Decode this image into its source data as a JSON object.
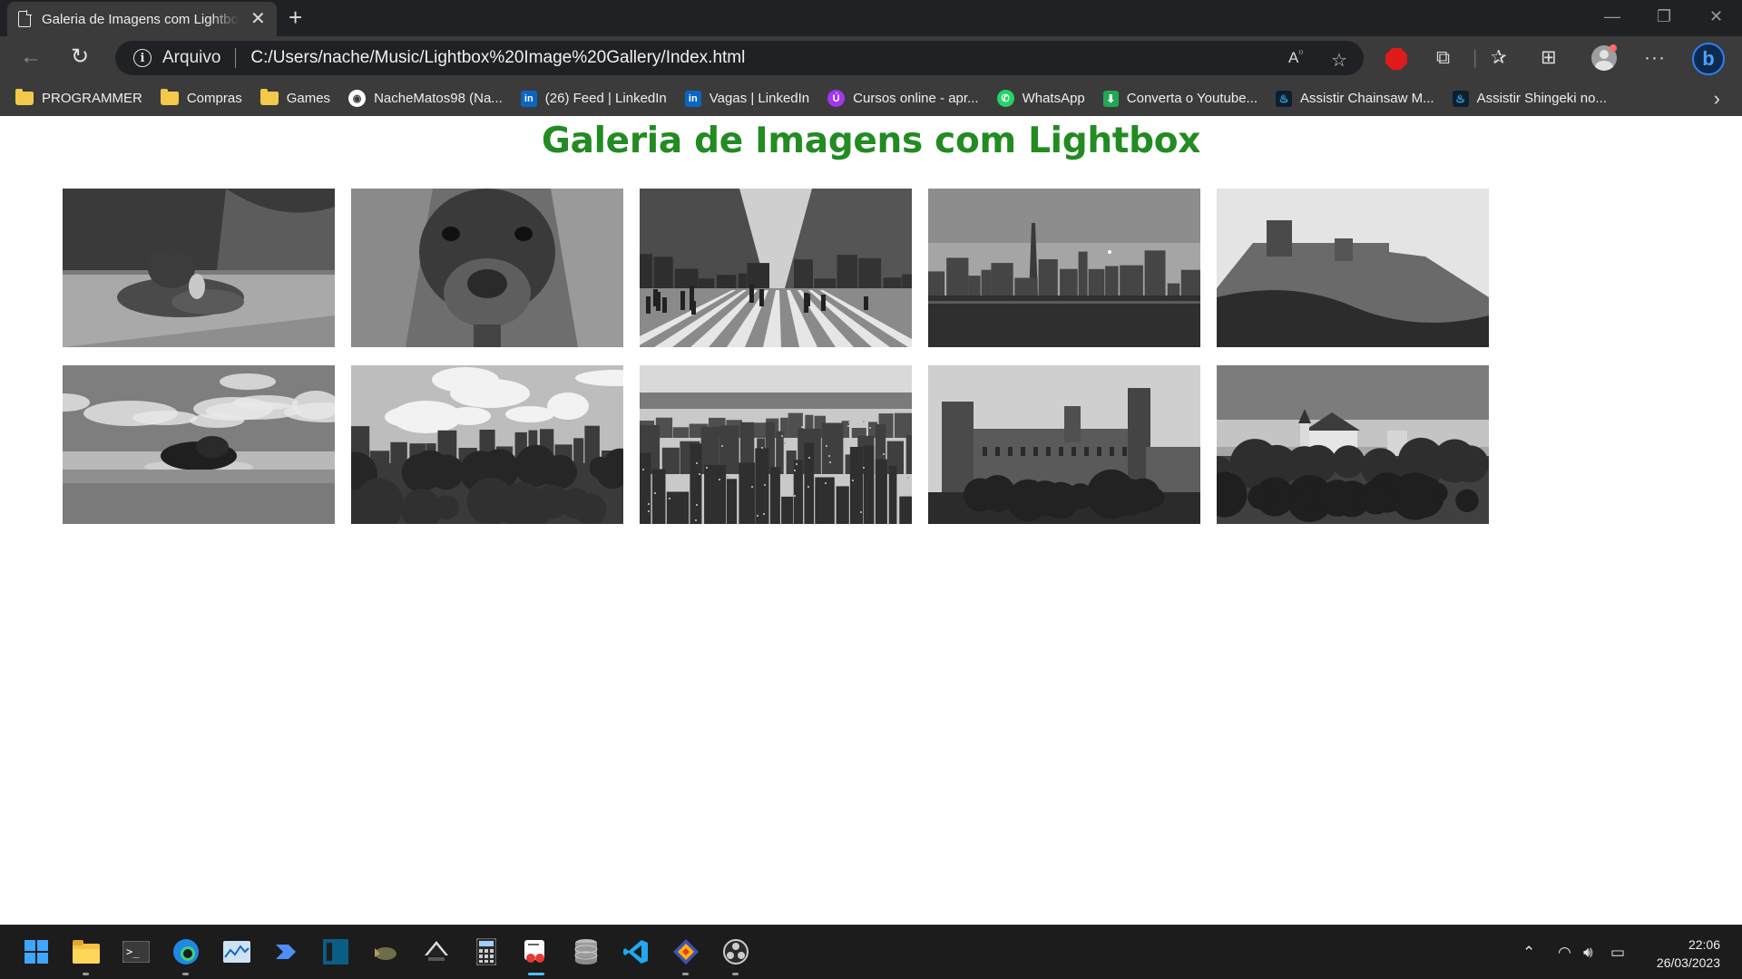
{
  "browser": {
    "tab_title": "Galeria de Imagens com Lightbox",
    "security_label": "Arquivo",
    "url": "C:/Users/nache/Music/Lightbox%20Image%20Gallery/Index.html",
    "read_aloud_label": "A₀"
  },
  "bookmarks": [
    {
      "label": "PROGRAMMER",
      "icon": "folder-icon"
    },
    {
      "label": "Compras",
      "icon": "folder-icon"
    },
    {
      "label": "Games",
      "icon": "folder-icon"
    },
    {
      "label": "NacheMatos98 (Na...",
      "icon": "github-icon"
    },
    {
      "label": "(26) Feed | LinkedIn",
      "icon": "linkedin-icon"
    },
    {
      "label": "Vagas | LinkedIn",
      "icon": "linkedin-icon"
    },
    {
      "label": "Cursos online - apr...",
      "icon": "udemy-icon"
    },
    {
      "label": "WhatsApp",
      "icon": "whatsapp-icon"
    },
    {
      "label": "Converta o Youtube...",
      "icon": "download-icon"
    },
    {
      "label": "Assistir Chainsaw M...",
      "icon": "flame-icon"
    },
    {
      "label": "Assistir Shingeki no...",
      "icon": "flame-icon"
    }
  ],
  "page": {
    "title": "Galeria de Imagens com Lightbox",
    "title_color": "#228b22",
    "gallery": [
      {
        "subject": "dog-lying-on-pavement"
      },
      {
        "subject": "dog-closeup-nose"
      },
      {
        "subject": "city-street-crosswalk"
      },
      {
        "subject": "city-skyline-waterfront"
      },
      {
        "subject": "castle-on-cliff"
      },
      {
        "subject": "tropical-island"
      },
      {
        "subject": "city-skyline-park"
      },
      {
        "subject": "aerial-city-skyscrapers"
      },
      {
        "subject": "stone-castle"
      },
      {
        "subject": "fairytale-castle-forest"
      }
    ]
  },
  "taskbar": {
    "apps": [
      "start-icon",
      "file-explorer-icon",
      "terminal-icon",
      "edge-icon",
      "task-manager-icon",
      "power-automate-icon",
      "jetbrains-icon",
      "crossover-icon",
      "inkscape-icon",
      "calculator-icon",
      "snipping-tool-icon",
      "database-icon",
      "vscode-icon",
      "git-icon",
      "obs-icon"
    ],
    "time": "22:06",
    "date": "26/03/2023"
  }
}
